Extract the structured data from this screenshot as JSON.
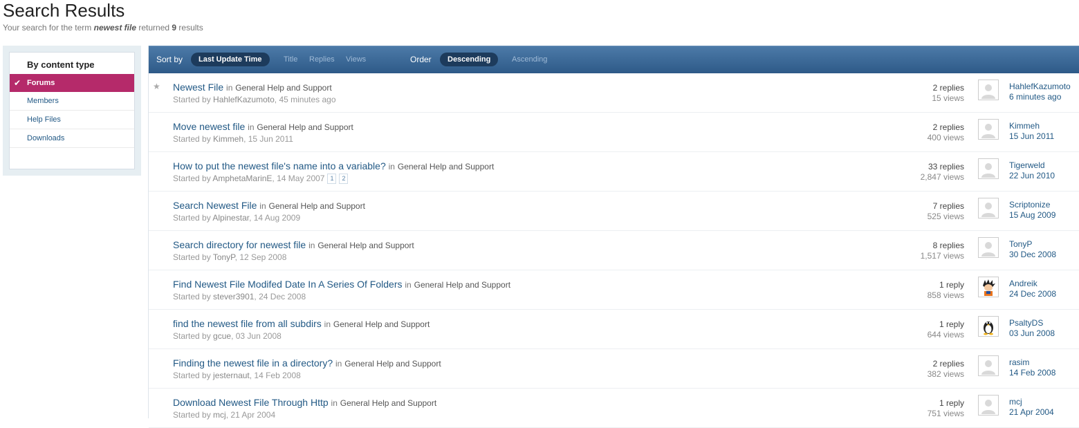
{
  "header": {
    "title": "Search Results",
    "summary_prefix": "Your search for the term",
    "term": "newest file",
    "summary_mid": "returned",
    "count": "9",
    "summary_suffix": "results"
  },
  "sidebar": {
    "heading": "By content type",
    "items": [
      {
        "label": "Forums",
        "active": true
      },
      {
        "label": "Members",
        "active": false
      },
      {
        "label": "Help Files",
        "active": false
      },
      {
        "label": "Downloads",
        "active": false
      }
    ]
  },
  "sortbar": {
    "sort_label": "Sort by",
    "sort_active": "Last Update Time",
    "sort_options": [
      "Title",
      "Replies",
      "Views"
    ],
    "order_label": "Order",
    "order_active": "Descending",
    "order_options": [
      "Ascending"
    ]
  },
  "in_word": "in",
  "started_by": "Started by",
  "topics": [
    {
      "title": "Newest File",
      "forum": "General Help and Support",
      "author": "HahlefKazumoto",
      "date": "45 minutes ago",
      "replies": "2 replies",
      "views": "15 views",
      "last_user": "HahlefKazumoto",
      "last_date": "6 minutes ago",
      "avatar": "default",
      "starred": true,
      "pages": []
    },
    {
      "title": "Move newest file",
      "forum": "General Help and Support",
      "author": "Kimmeh",
      "date": "15 Jun 2011",
      "replies": "2 replies",
      "views": "400 views",
      "last_user": "Kimmeh",
      "last_date": "15 Jun 2011",
      "avatar": "default",
      "starred": false,
      "pages": []
    },
    {
      "title": "How to put the newest file's name into a variable?",
      "forum": "General Help and Support",
      "author": "AmphetaMarinE",
      "date": "14 May 2007",
      "replies": "33 replies",
      "views": "2,847 views",
      "last_user": "Tigerweld",
      "last_date": "22 Jun 2010",
      "avatar": "default",
      "starred": false,
      "pages": [
        "1",
        "2"
      ]
    },
    {
      "title": "Search Newest File",
      "forum": "General Help and Support",
      "author": "Alpinestar",
      "date": "14 Aug 2009",
      "replies": "7 replies",
      "views": "525 views",
      "last_user": "Scriptonize",
      "last_date": "15 Aug 2009",
      "avatar": "default",
      "starred": false,
      "pages": []
    },
    {
      "title": "Search directory for newest file",
      "forum": "General Help and Support",
      "author": "TonyP",
      "date": "12 Sep 2008",
      "replies": "8 replies",
      "views": "1,517 views",
      "last_user": "TonyP",
      "last_date": "30 Dec 2008",
      "avatar": "default",
      "starred": false,
      "pages": []
    },
    {
      "title": "Find Newest File Modifed Date In A Series Of Folders",
      "forum": "General Help and Support",
      "author": "stever3901",
      "date": "24 Dec 2008",
      "replies": "1 reply",
      "views": "858 views",
      "last_user": "Andreik",
      "last_date": "24 Dec 2008",
      "avatar": "goku",
      "starred": false,
      "pages": []
    },
    {
      "title": "find the newest file from all subdirs",
      "forum": "General Help and Support",
      "author": "gcue",
      "date": "03 Jun 2008",
      "replies": "1 reply",
      "views": "644 views",
      "last_user": "PsaltyDS",
      "last_date": "03 Jun 2008",
      "avatar": "penguin",
      "starred": false,
      "pages": []
    },
    {
      "title": "Finding the newest file in a directory?",
      "forum": "General Help and Support",
      "author": "jesternaut",
      "date": "14 Feb 2008",
      "replies": "2 replies",
      "views": "382 views",
      "last_user": "rasim",
      "last_date": "14 Feb 2008",
      "avatar": "default",
      "starred": false,
      "pages": []
    },
    {
      "title": "Download Newest File Through Http",
      "forum": "General Help and Support",
      "author": "mcj",
      "date": "21 Apr 2004",
      "replies": "1 reply",
      "views": "751 views",
      "last_user": "mcj",
      "last_date": "21 Apr 2004",
      "avatar": "default",
      "starred": false,
      "pages": []
    }
  ],
  "colors": {
    "link": "#225985",
    "active_sidebar": "#b52a6a",
    "sortbar": "#3a6898",
    "pill": "#1d3b5c"
  }
}
